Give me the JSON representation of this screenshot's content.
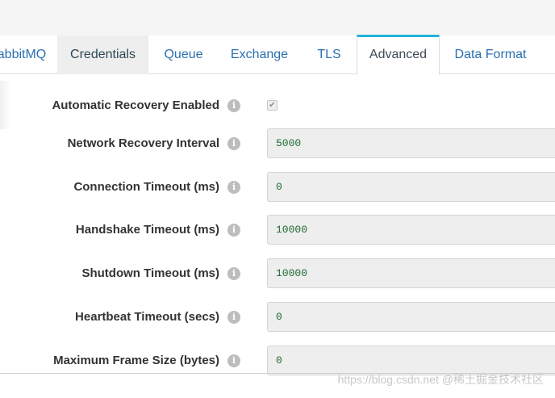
{
  "tabs": [
    {
      "label": "abbitMQ",
      "state": "normal"
    },
    {
      "label": "Credentials",
      "state": "hover"
    },
    {
      "label": "Queue",
      "state": "normal"
    },
    {
      "label": "Exchange",
      "state": "normal"
    },
    {
      "label": "TLS",
      "state": "normal"
    },
    {
      "label": "Advanced",
      "state": "active"
    },
    {
      "label": "Data Format",
      "state": "normal"
    }
  ],
  "form": {
    "automatic_recovery": {
      "label": "Automatic Recovery Enabled",
      "checked": true,
      "check_glyph": "✔"
    },
    "network_recovery_interval": {
      "label": "Network Recovery Interval",
      "value": "5000"
    },
    "connection_timeout": {
      "label": "Connection Timeout (ms)",
      "value": "0"
    },
    "handshake_timeout": {
      "label": "Handshake Timeout (ms)",
      "value": "10000"
    },
    "shutdown_timeout": {
      "label": "Shutdown Timeout (ms)",
      "value": "10000"
    },
    "heartbeat_timeout": {
      "label": "Heartbeat Timeout (secs)",
      "value": "0"
    },
    "max_frame_size": {
      "label": "Maximum Frame Size (bytes)",
      "value": "0"
    }
  },
  "info_glyph": "i",
  "watermark": "https://blog.csdn.net  @稀土掘金技术社区",
  "colors": {
    "tab_text": "#2a6fb0",
    "tab_active_accent": "#22b2dd",
    "field_text": "#1e6b33",
    "field_bg": "#eeeeee"
  }
}
